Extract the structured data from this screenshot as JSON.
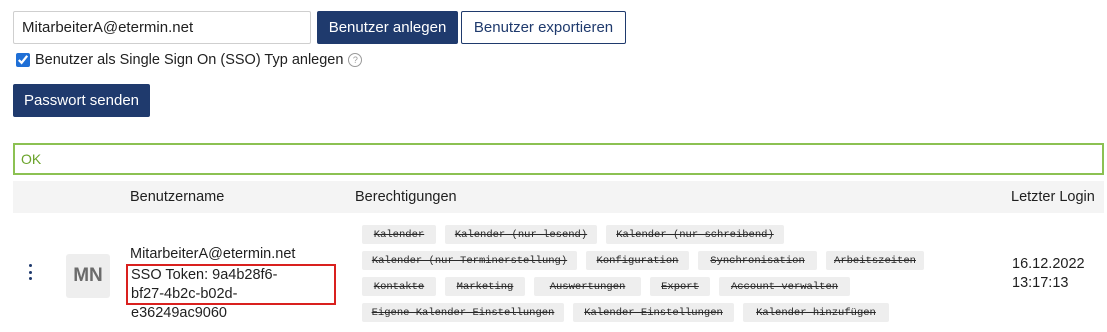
{
  "form": {
    "email_value": "MitarbeiterA@etermin.net",
    "create_label": "Benutzer anlegen",
    "export_label": "Benutzer exportieren",
    "sso_label": "Benutzer als Single Sign On (SSO) Typ anlegen",
    "sso_checked": true,
    "help_icon": "?",
    "password_label": "Passwort senden"
  },
  "status": {
    "message": "OK"
  },
  "table": {
    "headers": {
      "username": "Benutzername",
      "permissions": "Berechtigungen",
      "last_login": "Letzter Login"
    },
    "rows": [
      {
        "avatar_initials": "MN",
        "username": "MitarbeiterA@etermin.net",
        "token_line1": "SSO Token: 9a4b28f6-",
        "token_line2": "bf27-4b2c-b02d-e36249ac9060",
        "permissions": [
          "Kalender",
          "Kalender (nur lesend)",
          "Kalender (nur schreibend)",
          "Kalender (nur Terminerstellung)",
          "Konfiguration",
          "Synchronisation",
          "Arbeitszeiten",
          "Kontakte",
          "Marketing",
          "Auswertungen",
          "Export",
          "Account verwalten",
          "Eigene Kalender Einstellungen",
          "Kalender Einstellungen",
          "Kalender hinzufügen"
        ],
        "last_login_date": "16.12.2022",
        "last_login_time": "13:17:13"
      }
    ]
  },
  "colors": {
    "primary": "#1f3a6d",
    "ok_border": "#8cc152",
    "highlight_border": "#d9201e"
  }
}
